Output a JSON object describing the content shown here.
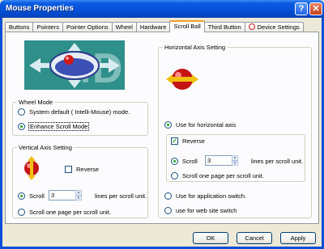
{
  "window": {
    "title": "Mouse Properties"
  },
  "tabs": [
    {
      "label": "Buttons"
    },
    {
      "label": "Pointers"
    },
    {
      "label": "Pointer Options"
    },
    {
      "label": "Wheel"
    },
    {
      "label": "Hardware"
    },
    {
      "label": "Scroll Ball"
    },
    {
      "label": "Third Button"
    },
    {
      "label": "Device Settings"
    }
  ],
  "active_tab": "Scroll Ball",
  "wheel_mode": {
    "title": "Wheel Mode",
    "option_default": "System default ( Intelli-Mouse) mode.",
    "option_enhance": "Enhance Scroll Mode"
  },
  "vertical": {
    "title": "Vertical Axis Setting",
    "reverse_label": "Reverse",
    "scroll_label": "Scroll",
    "scroll_value": "3",
    "lines_label": "lines per scroll unit.",
    "one_page_label": "Scroll one page per scroll unit."
  },
  "horizontal": {
    "title": "Horizontal Axis Setting",
    "use_horizontal_label": "Use for horizontal axis",
    "reverse_label": "Reverse",
    "scroll_label": "Scroll",
    "scroll_value": "3",
    "lines_label": "lines per scroll unit.",
    "one_page_label": "Scroll one page per scroll unit.",
    "app_switch_label": "Use for application switch.",
    "web_switch_label": "use for web site switch"
  },
  "buttons": {
    "ok": "OK",
    "cancel": "Cancel",
    "apply": "Apply"
  },
  "colors": {
    "title_bar": "#0553d8",
    "tab_highlight": "#f0a030",
    "radio_dot": "#21a121"
  }
}
